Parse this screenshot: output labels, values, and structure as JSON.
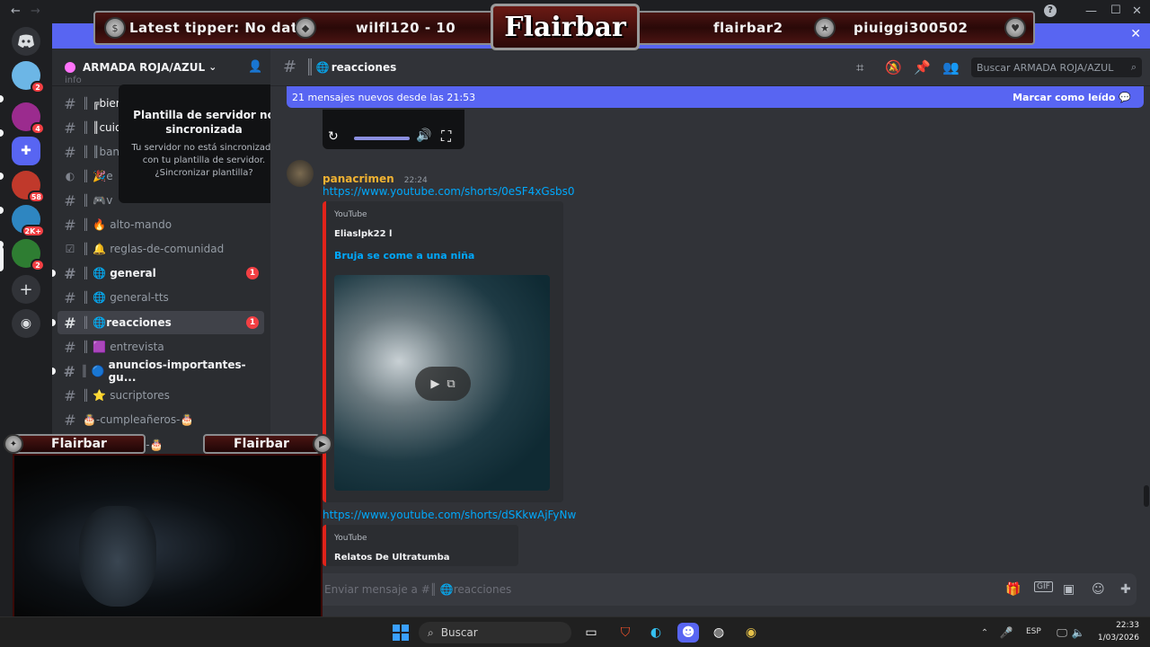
{
  "window": {
    "back_glyph": "←",
    "forward_glyph": "→",
    "help": "?",
    "minimize": "—",
    "maximize": "☐",
    "close": "✕"
  },
  "flairbar": {
    "latest_tipper": "Latest tipper: No data",
    "user1": "wilfl120 - 10",
    "logo": "Flairbar",
    "user2": "flairbar2",
    "user3": "piuiggi300502",
    "close": "✕"
  },
  "servers": [
    {
      "badge": "2",
      "color": "#6cb6e6"
    },
    {
      "badge": "4",
      "color": "#9b2b8e"
    },
    {
      "badge": "",
      "color": "#5865f2"
    },
    {
      "badge": "58",
      "color": "#c0392b"
    },
    {
      "badge": "2K+",
      "color": "#2e86c1"
    },
    {
      "badge": "2",
      "color": "#2e7d32"
    }
  ],
  "server": {
    "name": "ARMADA ROJA/AZUL",
    "chevron": "⌄"
  },
  "popup": {
    "title": "Plantilla de servidor no sincronizada",
    "body": "Tu servidor no está sincronizado con tu plantilla de servidor. ¿Sincronizar plantilla?",
    "close": "✕"
  },
  "channels": [
    {
      "emoji": "",
      "name": "info"
    },
    {
      "emoji": "",
      "name": "╔bienv"
    },
    {
      "emoji": "",
      "name": "║cuida"
    },
    {
      "emoji": "",
      "name": "║banea"
    },
    {
      "emoji": "🎉",
      "name": "e"
    },
    {
      "emoji": "🎮",
      "name": "v"
    },
    {
      "emoji": "🔥",
      "name": "alto-mando"
    },
    {
      "emoji": "🔔",
      "name": "reglas-de-comunidad"
    },
    {
      "emoji": "🌐",
      "name": "general",
      "badge": "1"
    },
    {
      "emoji": "🌐",
      "name": "general-tts"
    },
    {
      "emoji": "🌐",
      "name": "reacciones",
      "badge": "1"
    },
    {
      "emoji": "🟪",
      "name": "entrevista"
    },
    {
      "emoji": "🔵",
      "name": "anuncios-importantes-gu..."
    },
    {
      "emoji": "⭐",
      "name": "sucriptores"
    },
    {
      "emoji": "🎂",
      "name": "-cumpleañeros-🎂"
    },
    {
      "emoji": "",
      "name": "día-🎂"
    }
  ],
  "header": {
    "channel": "reacciones",
    "search_placeholder": "Buscar ARMADA ROJA/AZUL"
  },
  "newbar": {
    "text": "21 mensajes nuevos desde las 21:53",
    "action": "Marcar como leído"
  },
  "message": {
    "author": "panacrimen",
    "time": "22:24",
    "link1": "https://www.youtube.com/shorts/0eSF4xGsbs0",
    "embed1": {
      "provider": "YouTube",
      "author": "Eliaslpk22 l",
      "title": "Bruja se come a una niña"
    },
    "link2": "https://www.youtube.com/shorts/dSKkwAjFyNw",
    "embed2": {
      "provider": "YouTube",
      "author": "Relatos De Ultratumba"
    }
  },
  "composer": {
    "placeholder": "Enviar mensaje a #║ 🌐reacciones"
  },
  "cam": {
    "tag": "Flairbar"
  },
  "taskbar": {
    "search": "Buscar",
    "lang": "ESP",
    "time": "22:33",
    "date": "1/03/2026"
  }
}
